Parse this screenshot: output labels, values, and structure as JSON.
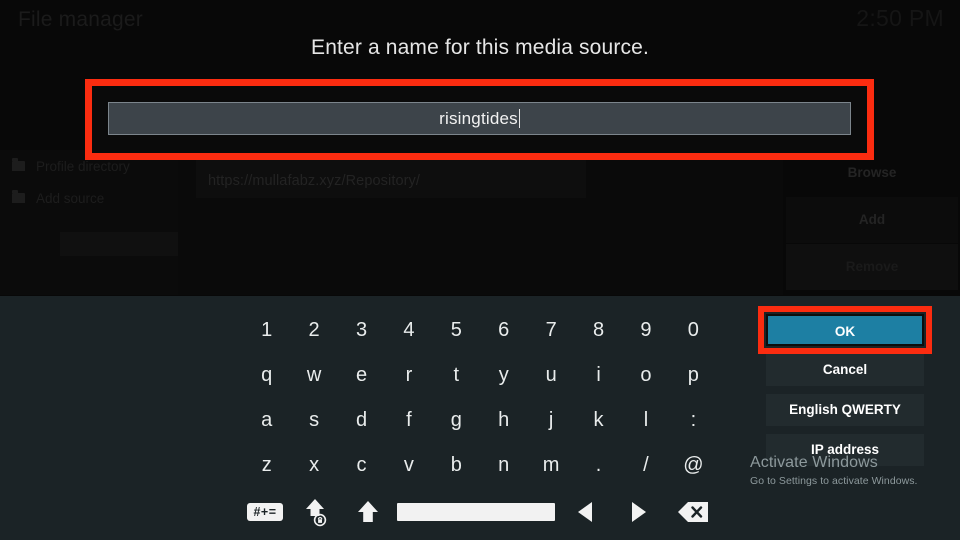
{
  "window": {
    "title": "File manager",
    "clock": "2:50 PM"
  },
  "background": {
    "sidebar_items": [
      {
        "label": "Profile directory",
        "icon": "folder-icon"
      },
      {
        "label": "Add source",
        "icon": "folder-icon"
      }
    ],
    "source_url": "https://mullafabz.xyz/Repository/",
    "buttons": [
      {
        "label": "Browse"
      },
      {
        "label": "Add"
      },
      {
        "label": "Remove"
      }
    ]
  },
  "dialog": {
    "prompt": "Enter a name for this media source.",
    "input": {
      "value": "risingtides",
      "placeholder": "",
      "caret": true
    }
  },
  "keyboard": {
    "rows": [
      [
        "1",
        "2",
        "3",
        "4",
        "5",
        "6",
        "7",
        "8",
        "9",
        "0"
      ],
      [
        "q",
        "w",
        "e",
        "r",
        "t",
        "y",
        "u",
        "i",
        "o",
        "p"
      ],
      [
        "a",
        "s",
        "d",
        "f",
        "g",
        "h",
        "j",
        "k",
        "l",
        ":"
      ],
      [
        "z",
        "x",
        "c",
        "v",
        "b",
        "n",
        "m",
        ".",
        "/",
        "@"
      ]
    ],
    "function_row": [
      {
        "name": "symbols-key",
        "label": "#+="
      },
      {
        "name": "caps-lock-key",
        "label": ""
      },
      {
        "name": "shift-key",
        "label": ""
      },
      {
        "name": "spacebar-key",
        "label": ""
      },
      {
        "name": "cursor-left-key",
        "label": ""
      },
      {
        "name": "cursor-right-key",
        "label": ""
      },
      {
        "name": "backspace-key",
        "label": ""
      }
    ]
  },
  "actions": [
    {
      "id": "ok",
      "label": "OK",
      "highlighted": true
    },
    {
      "id": "cancel",
      "label": "Cancel",
      "highlighted": false
    },
    {
      "id": "layout",
      "label": "English QWERTY",
      "highlighted": false
    },
    {
      "id": "ip",
      "label": "IP address",
      "highlighted": false
    }
  ],
  "watermark": {
    "title": "Activate Windows",
    "subtitle": "Go to Settings to activate Windows."
  },
  "colors": {
    "annotation_red": "#fb2c10",
    "primary_blue": "#1d7fa3",
    "keyboard_bg": "#1b2326",
    "input_bg": "#3d444a"
  }
}
